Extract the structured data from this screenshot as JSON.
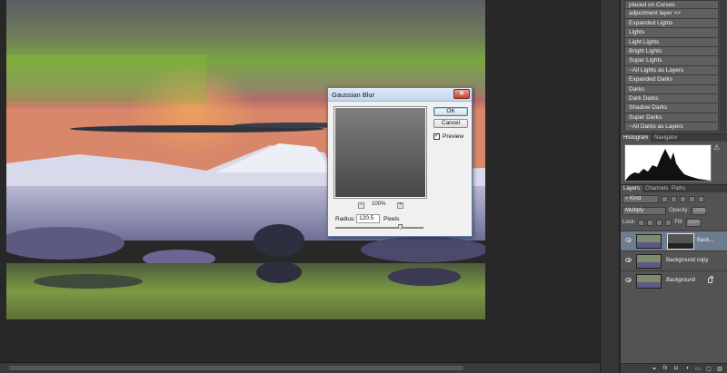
{
  "actions": [
    "placed on Curves",
    "adjustment layer >>",
    "Expanded Lights",
    "Lights",
    "Light Lights",
    "Bright Lights",
    "Super Lights",
    "~All Lights as Layers",
    "Expanded Darks",
    "Darks",
    "Dark Darks",
    "Shadow Darks",
    "Super Darks",
    "~All Darks as Layers"
  ],
  "histogram_panel": {
    "tabs": [
      "Histogram",
      "Navigator"
    ],
    "active_tab": "Histogram",
    "warning_icon": "warning-triangle-icon"
  },
  "layers_panel": {
    "tabs": [
      "Layers",
      "Channels",
      "Paths"
    ],
    "active_tab": "Layers",
    "filter_kind": "Kind",
    "blend_mode": "Multiply",
    "opacity_label": "Opacity:",
    "opacity_value": "100%",
    "lock_label": "Lock:",
    "fill_label": "Fill:",
    "fill_value": "100%",
    "layers": [
      {
        "name": "Back...",
        "selected": true,
        "has_mask": true
      },
      {
        "name": "Background copy",
        "selected": false,
        "has_mask": false
      },
      {
        "name": "Background",
        "selected": false,
        "has_mask": false,
        "locked": true
      }
    ],
    "footer_icons": [
      "link-icon",
      "fx-icon",
      "mask-icon",
      "adjustment-icon",
      "folder-icon",
      "new-layer-icon",
      "trash-icon"
    ],
    "footer_glyphs": [
      "⚭",
      "fx",
      "◘",
      "◑",
      "▭",
      "▢",
      "▥"
    ]
  },
  "dialog": {
    "title": "Gaussian Blur",
    "close_glyph": "✕",
    "ok_label": "OK",
    "cancel_label": "Cancel",
    "preview_label": "Preview",
    "preview_checked": true,
    "check_glyph": "✓",
    "zoom_value": "100%",
    "zoom_out_glyph": "−",
    "zoom_in_glyph": "+",
    "radius_label": "Radius:",
    "radius_value": "120.5",
    "radius_unit": "Pixels",
    "radius_slider_fraction": 0.74
  },
  "colors": {
    "panel_bg": "#535353",
    "selected_layer": "#6d7c8f",
    "workspace_bg": "#282828"
  }
}
